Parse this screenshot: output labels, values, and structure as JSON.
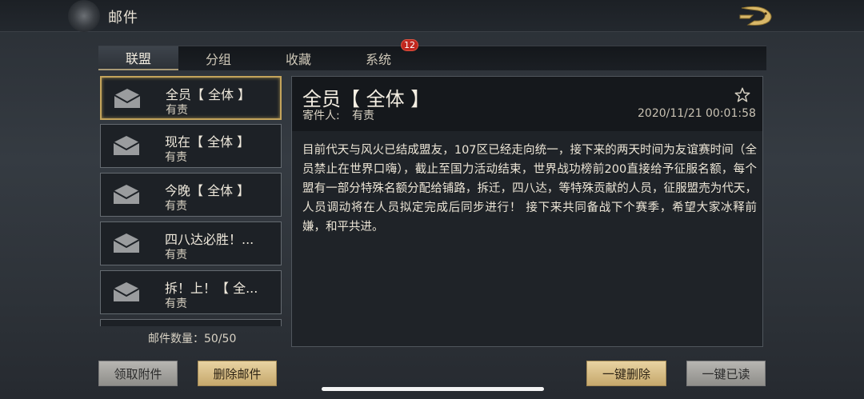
{
  "header": {
    "title": "邮件"
  },
  "tabs": [
    {
      "label": "联盟",
      "active": true
    },
    {
      "label": "分组",
      "active": false
    },
    {
      "label": "收藏",
      "active": false
    },
    {
      "label": "系统",
      "active": false,
      "badge": "12"
    }
  ],
  "mail_list": [
    {
      "title": "全员【 全体 】",
      "sender": "有责",
      "selected": true
    },
    {
      "title": "现在【 全体 】",
      "sender": "有责",
      "selected": false
    },
    {
      "title": "今晚【 全体 】",
      "sender": "有责",
      "selected": false
    },
    {
      "title": "四八达必胜！...",
      "sender": "有责",
      "selected": false
    },
    {
      "title": "拆！上！【 全...",
      "sender": "有责",
      "selected": false
    }
  ],
  "mail_count": "邮件数量：50/50",
  "detail": {
    "title": "全员【 全体 】",
    "sender_label": "寄件人:",
    "sender_name": "有责",
    "date": "2020/11/21",
    "time": "00:01:58",
    "body": "目前代天与风火已结成盟友，107区已经走向统一，接下来的两天时间为友谊赛时间（全员禁止在世界口嗨），截止至国力活动结束，世界战功榜前200直接给予征服名额，每个盟有一部分特殊名额分配给铺路，拆迁，四八达，等特殊贡献的人员，征服盟売为代天，人员调动将在人员拟定完成后同步进行！ 接下来共同备战下个赛季，希望大家冰释前嫌，和平共进。"
  },
  "buttons": {
    "claim_attachments": "领取附件",
    "delete_mail": "删除邮件",
    "delete_all": "一键删除",
    "read_all": "一键已读"
  },
  "colors": {
    "accent_gold": "#c4a45b",
    "badge_red": "#c1271f",
    "panel_dark": "#1f2328"
  }
}
